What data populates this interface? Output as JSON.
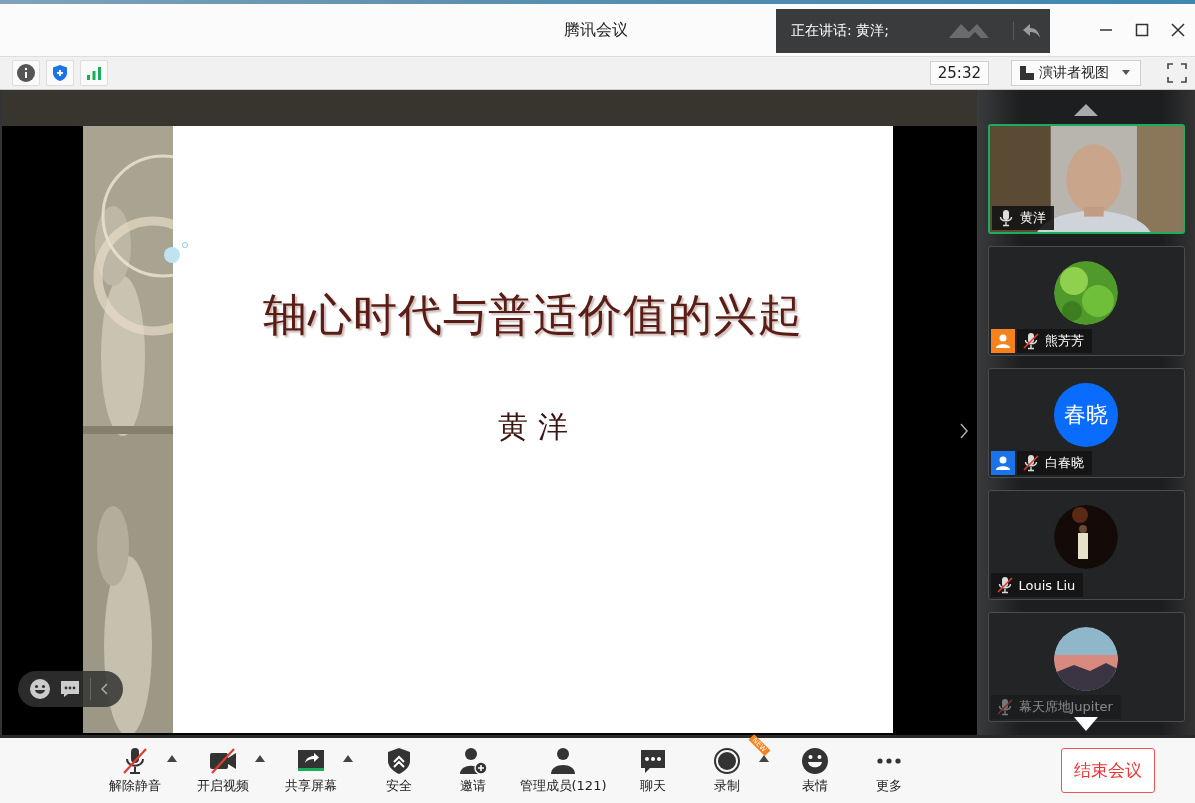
{
  "window": {
    "title": "腾讯会议",
    "speaking": "正在讲话: 黄洋;"
  },
  "toolbar": {
    "timer": "25:32",
    "view": "演讲者视图"
  },
  "slide": {
    "title": "轴心时代与普适价值的兴起",
    "author": "黄 洋"
  },
  "participants": [
    {
      "name": "黄洋",
      "kind": "video",
      "muted": false,
      "speaking": true,
      "faded": false
    },
    {
      "name": "熊芳芳",
      "muted": true,
      "speaking": false,
      "faded": false,
      "color": "#f5821f"
    },
    {
      "name": "白春晓",
      "kind": "initials",
      "avatar_text": "春晓",
      "muted": true,
      "speaking": false,
      "faded": false,
      "color": "#1a73e8"
    },
    {
      "name": "Louis Liu",
      "muted": true,
      "speaking": false,
      "faded": false
    },
    {
      "name": "幕天席地Jupiter",
      "muted": true,
      "speaking": false,
      "faded": true
    }
  ],
  "controls": [
    {
      "label": "解除静音",
      "kind": "mic",
      "off": true,
      "menu": true
    },
    {
      "label": "开启视频",
      "kind": "camera",
      "off": true,
      "menu": true
    },
    {
      "label": "共享屏幕",
      "kind": "share",
      "off": false,
      "menu": true
    },
    {
      "label": "安全",
      "kind": "shield",
      "off": false,
      "menu": false
    },
    {
      "label": "邀请",
      "kind": "invite",
      "off": false,
      "menu": false
    },
    {
      "label": "管理成员(121)",
      "kind": "members",
      "off": false,
      "menu": false
    },
    {
      "label": "聊天",
      "kind": "chat",
      "off": false,
      "menu": false
    },
    {
      "label": "录制",
      "kind": "record",
      "off": false,
      "menu": true,
      "badge": "NEW"
    },
    {
      "label": "表情",
      "kind": "emoji",
      "off": false,
      "menu": false
    },
    {
      "label": "更多",
      "kind": "more",
      "off": false,
      "menu": false
    }
  ],
  "end_button": "结束会议"
}
